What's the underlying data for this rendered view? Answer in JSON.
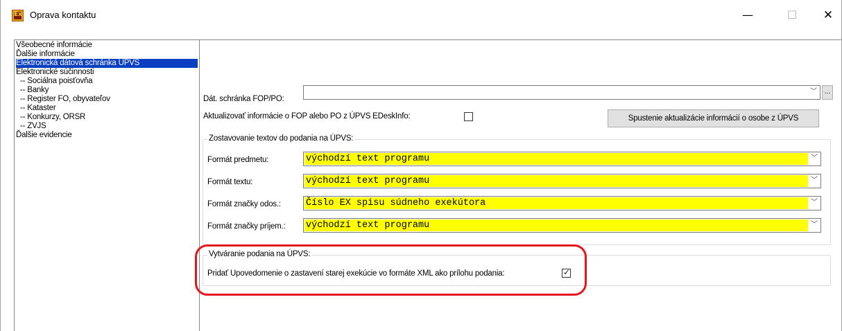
{
  "window": {
    "title": "Oprava kontaktu",
    "icon": "app-ex-icon",
    "minimize_glyph": "—",
    "maximize_glyph": "☐",
    "close_glyph": "✕"
  },
  "tree": {
    "items": [
      {
        "label": "Všeobecné informácie",
        "selected": false
      },
      {
        "label": "Ďalšie informácie",
        "selected": false
      },
      {
        "label": "Elektronická dátová schránka ÚPVS",
        "selected": true
      },
      {
        "label": "Elektronické súčinnosti",
        "selected": false
      },
      {
        "label": "-- Sociálna poisťovňa",
        "selected": false
      },
      {
        "label": "-- Banky",
        "selected": false
      },
      {
        "label": "-- Register FO, obyvateľov",
        "selected": false
      },
      {
        "label": "-- Kataster",
        "selected": false
      },
      {
        "label": "-- Konkurzy, ORSR",
        "selected": false
      },
      {
        "label": "-- ZVJS",
        "selected": false
      },
      {
        "label": "Ďalšie evidencie",
        "selected": false
      }
    ]
  },
  "panel": {
    "mailbox_label": "Dát. schránka FOP/PO:",
    "mailbox_value": "",
    "ellipsis_label": "...",
    "update_info_label": "Aktualizovať informácie o FOP alebo PO z ÚPVS EDeskInfo:",
    "update_info_checked": false,
    "run_update_button": "Spustenie aktualizácie informácií o osobe z ÚPVS",
    "texts_group": {
      "title": "Zostavovanie textov do podania na ÚPVS:",
      "fields": [
        {
          "label": "Formát predmetu:",
          "value": "východzí text programu"
        },
        {
          "label": "Formát textu:",
          "value": "východzí text programu"
        },
        {
          "label": "Formát značky odos.:",
          "value": "Číslo EX spisu súdneho exekútora"
        },
        {
          "label": "Formát značky príjem.:",
          "value": "východzí text programu"
        }
      ]
    },
    "create_group": {
      "title": "Vytváranie podania na ÚPVS:",
      "attach_label": "Pridať Upovedomenie o zastavení starej exekúcie vo formáte XML ako prílohu podania:",
      "attach_checked": true
    },
    "dropdown_arrow": "﹀"
  },
  "colors": {
    "field_highlight": "#ffff00",
    "selection": "#0a3fc4",
    "annotation": "#e8141b"
  }
}
